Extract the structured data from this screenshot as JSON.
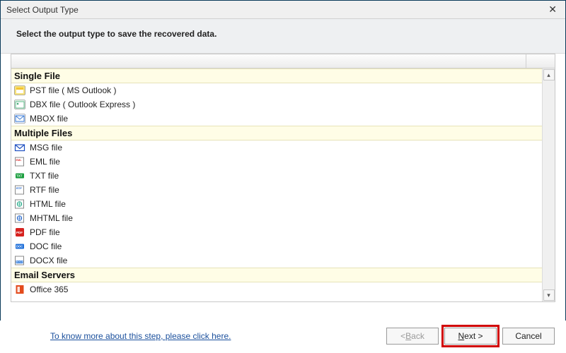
{
  "window": {
    "title": "Select Output Type",
    "close_glyph": "✕"
  },
  "instruction": "Select the output type to save the recovered data.",
  "sections": [
    {
      "title": "Single File",
      "items": [
        {
          "icon": "pst",
          "label": "PST file ( MS Outlook )"
        },
        {
          "icon": "dbx",
          "label": "DBX file ( Outlook Express )"
        },
        {
          "icon": "mbox",
          "label": "MBOX file"
        }
      ]
    },
    {
      "title": "Multiple Files",
      "items": [
        {
          "icon": "msg",
          "label": "MSG file"
        },
        {
          "icon": "eml",
          "label": "EML file"
        },
        {
          "icon": "txt",
          "label": "TXT file"
        },
        {
          "icon": "rtf",
          "label": "RTF file"
        },
        {
          "icon": "html",
          "label": "HTML file"
        },
        {
          "icon": "mhtml",
          "label": "MHTML file"
        },
        {
          "icon": "pdf",
          "label": "PDF file"
        },
        {
          "icon": "doc",
          "label": "DOC file"
        },
        {
          "icon": "docx",
          "label": "DOCX file"
        }
      ]
    },
    {
      "title": "Email Servers",
      "items": [
        {
          "icon": "o365",
          "label": "Office 365"
        }
      ]
    }
  ],
  "footer": {
    "help_link": "To know more about this step, please click here.",
    "back": {
      "prefix": "< ",
      "mn": "B",
      "rest": "ack"
    },
    "next": {
      "mn": "N",
      "rest": "ext >"
    },
    "cancel": "Cancel"
  }
}
